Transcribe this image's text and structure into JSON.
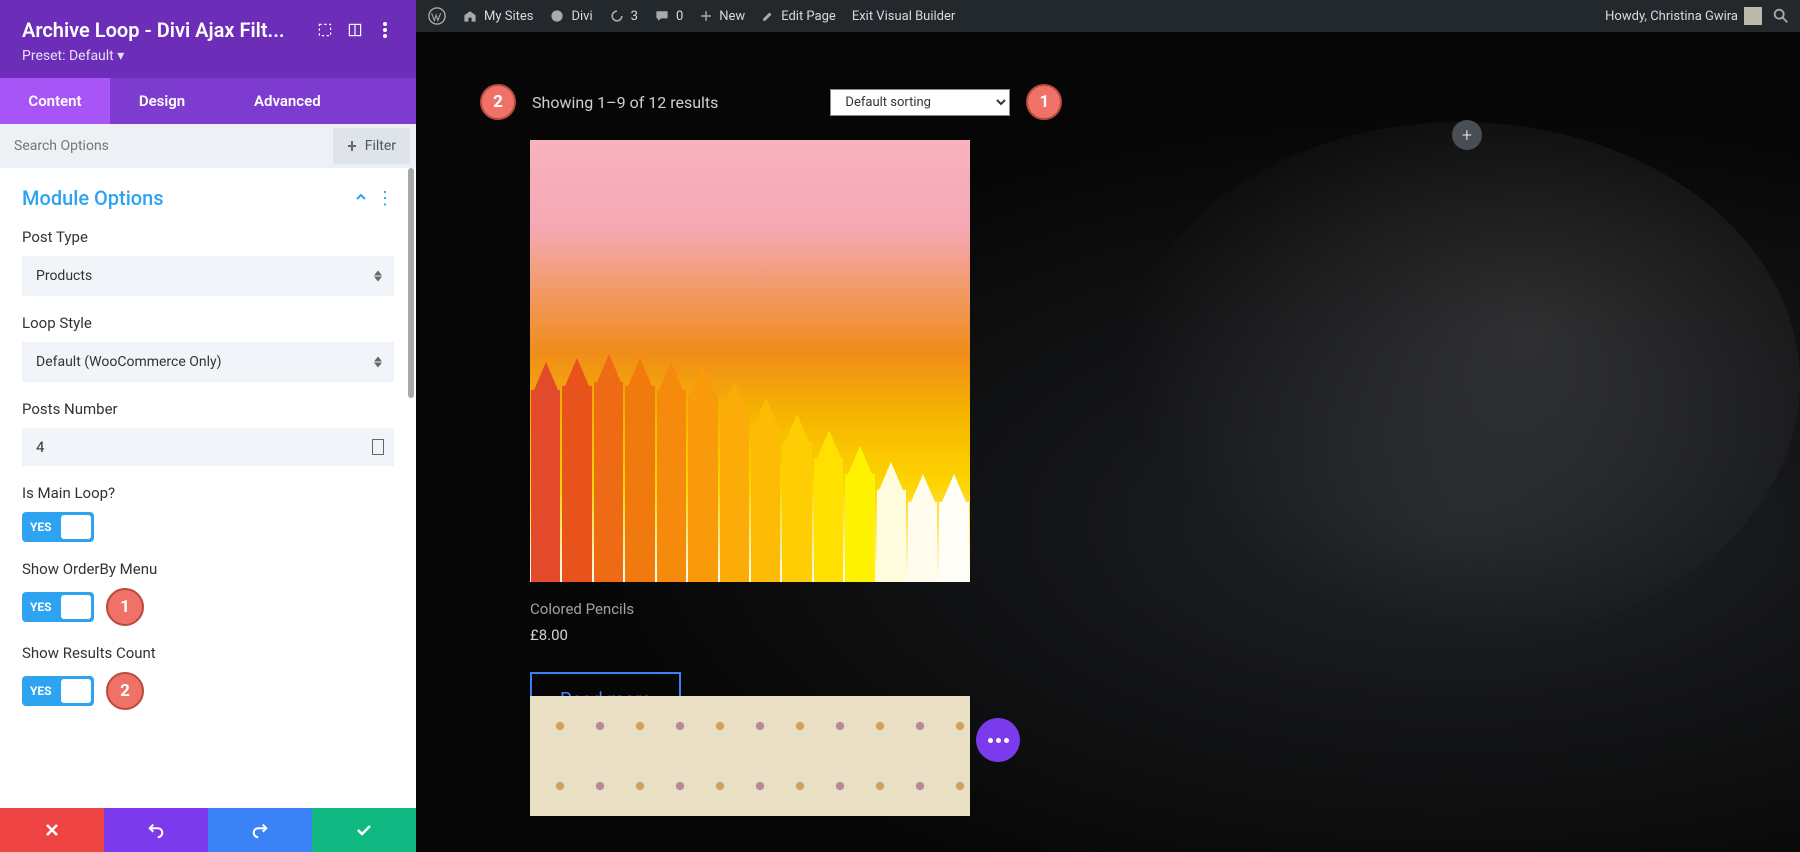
{
  "adminbar": {
    "mysites": "My Sites",
    "site_name": "Divi",
    "updates": "3",
    "comments": "0",
    "new": "New",
    "edit_page": "Edit Page",
    "exit_vb": "Exit Visual Builder",
    "howdy": "Howdy, Christina Gwira"
  },
  "sidebar": {
    "title": "Archive Loop - Divi Ajax Filt...",
    "preset": "Preset: Default ▾",
    "tabs": {
      "content": "Content",
      "design": "Design",
      "advanced": "Advanced"
    },
    "search_placeholder": "Search Options",
    "filter_label": "Filter",
    "section_title": "Module Options",
    "fields": {
      "post_type_label": "Post Type",
      "post_type_value": "Products",
      "loop_style_label": "Loop Style",
      "loop_style_value": "Default (WooCommerce Only)",
      "posts_number_label": "Posts Number",
      "posts_number_value": "4",
      "is_main_loop_label": "Is Main Loop?",
      "show_orderby_label": "Show OrderBy Menu",
      "show_results_count_label": "Show Results Count",
      "toggle_yes": "YES"
    },
    "annotations": {
      "orderby": "1",
      "results_count": "2"
    }
  },
  "canvas": {
    "annotations": {
      "results": "2",
      "sorting": "1"
    },
    "results_text": "Showing 1–9 of 12 results",
    "sorting_value": "Default sorting",
    "product": {
      "name": "Colored Pencils",
      "price": "£8.00",
      "cta": "Read more"
    },
    "add_label": "+"
  },
  "pencil_colors": [
    "#e34a2b",
    "#e8531b",
    "#ee6a15",
    "#f17a0e",
    "#f58a0c",
    "#f89a0a",
    "#fbac08",
    "#fdbb06",
    "#fecd04",
    "#ffe000",
    "#fff200",
    "#fffbdd",
    "#fffcee",
    "#fefdf7"
  ]
}
